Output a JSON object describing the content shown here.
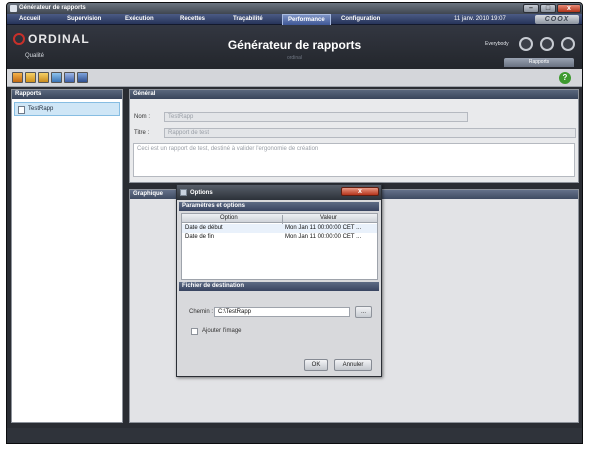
{
  "window": {
    "title": "Générateur de rapports",
    "controls": [
      "–",
      "□",
      "x"
    ]
  },
  "menu": {
    "items": [
      "Accueil",
      "Supervision",
      "Exécution",
      "Recettes",
      "Traçabilité",
      "Performance",
      "Configuration"
    ],
    "active": "Performance",
    "date": "11 janv. 2010 19:07",
    "brand_badge": "COOX"
  },
  "header": {
    "brand": "ORDINAL",
    "module": "Qualité",
    "title": "Générateur de rapports",
    "subtitle": "ordinal",
    "user": "Everybody",
    "tab": "Rapports"
  },
  "toolbar": {
    "tools": [
      "new-report-icon",
      "open-report-icon",
      "folder-icon",
      "export-icon",
      "save-icon",
      "print-icon"
    ],
    "help": "?"
  },
  "left_panel": {
    "heading": "Rapports",
    "items": [
      "TestRapp"
    ]
  },
  "general": {
    "heading": "Général",
    "name_label": "Nom :",
    "name_value": "TestRapp",
    "title_label": "Titre :",
    "title_value": "Rapport de test",
    "description": "Ceci est un rapport de test, destiné à valider l'ergonomie de création"
  },
  "graphique": {
    "heading": "Graphique"
  },
  "dialog": {
    "title": "Options",
    "close": "x",
    "params_heading": "Paramètres et options",
    "columns": [
      "Option",
      "Valeur"
    ],
    "rows": [
      {
        "option": "Date de début",
        "value": "Mon Jan 11 00:00:00 CET ..."
      },
      {
        "option": "Date de fin",
        "value": "Mon Jan 11 00:00:00 CET ..."
      }
    ],
    "dest_heading": "Fichier de destination",
    "path_label": "Chemin :",
    "path_value": "C:\\TestRapp",
    "browse": "...",
    "checkbox_label": "Ajouter l'image",
    "ok": "OK",
    "cancel": "Annuler"
  },
  "colors": {
    "menubar": "#27345a",
    "header": "#2a2d33",
    "selection": "#cfe6f6",
    "close_red": "#b4341b"
  }
}
